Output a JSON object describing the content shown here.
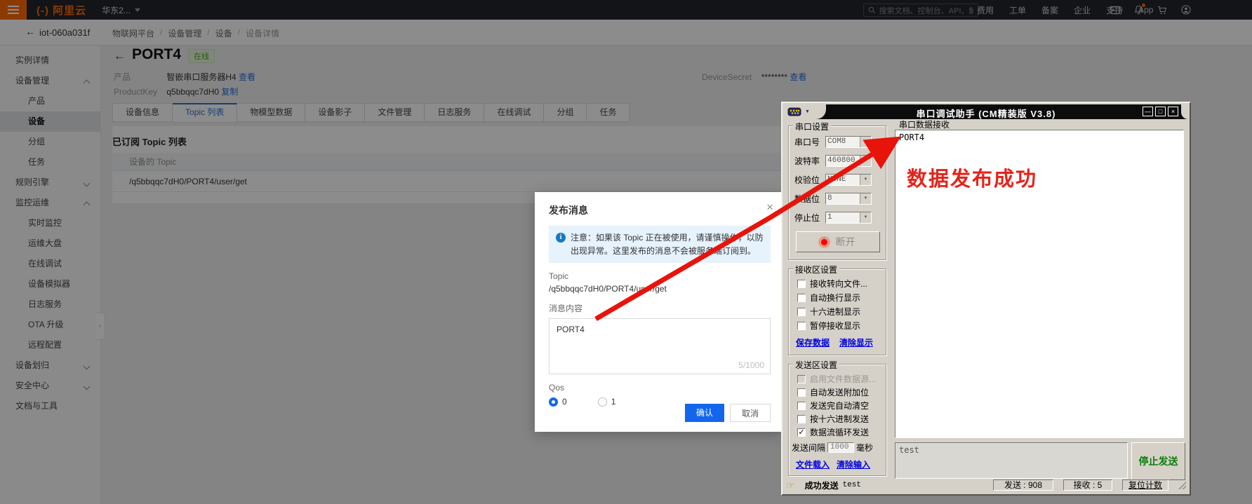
{
  "topbar": {
    "brand": "阿里云",
    "brand_mark": "(-)",
    "region": "华东2...",
    "search_placeholder": "搜索文档、控制台、API、解",
    "menu": [
      "费用",
      "工单",
      "备案",
      "企业",
      "支持",
      "App"
    ]
  },
  "subheader": {
    "back": "←",
    "instance": "iot-060a031f",
    "breadcrumb": [
      "物联网平台",
      "设备管理",
      "设备",
      "设备详情"
    ]
  },
  "sidebar": {
    "items": [
      {
        "label": "实例详情"
      },
      {
        "label": "设备管理"
      },
      {
        "label": "产品"
      },
      {
        "label": "设备"
      },
      {
        "label": "分组"
      },
      {
        "label": "任务"
      },
      {
        "label": "规则引擎"
      },
      {
        "label": "监控运维"
      },
      {
        "label": "实时监控"
      },
      {
        "label": "运维大盘"
      },
      {
        "label": "在线调试"
      },
      {
        "label": "设备模拟器"
      },
      {
        "label": "日志服务"
      },
      {
        "label": "OTA 升级"
      },
      {
        "label": "远程配置"
      },
      {
        "label": "设备划归"
      },
      {
        "label": "安全中心"
      },
      {
        "label": "文档与工具"
      }
    ],
    "collapse_glyph": "‹"
  },
  "device": {
    "back": "←",
    "title": "PORT4",
    "status": "在线",
    "product_label": "产品",
    "product_value": "智嵌串口服务器H4",
    "product_action": "查看",
    "pk_label": "ProductKey",
    "pk_value": "q5bbqqc7dH0",
    "pk_action": "复制",
    "secret_label": "DeviceSecret",
    "secret_value": "********",
    "secret_action": "查看"
  },
  "tabs": [
    "设备信息",
    "Topic 列表",
    "物模型数据",
    "设备影子",
    "文件管理",
    "日志服务",
    "在线调试",
    "分组",
    "任务"
  ],
  "topic_table": {
    "section_title": "已订阅 Topic 列表",
    "column": "设备的 Topic",
    "rows": [
      "/q5bbqqc7dH0/PORT4/user/get"
    ]
  },
  "modal": {
    "title": "发布消息",
    "close": "×",
    "notice": "注意：如果该 Topic 正在被使用，请谨慎操作，以防出现异常。这里发布的消息不会被服务端订阅到。",
    "topic_label": "Topic",
    "topic_value": "/q5bbqqc7dH0/PORT4/user/get",
    "content_label": "消息内容",
    "content_value": "PORT4",
    "counter": "5/1000",
    "qos_label": "Qos",
    "qos_options": [
      "0",
      "1"
    ],
    "confirm": "确认",
    "cancel": "取消"
  },
  "serial": {
    "title": "串口调试助手 (CM精装版 V3.8)",
    "win_buttons": {
      "min": "—",
      "max": "□",
      "close": "×"
    },
    "group_port": "串口设置",
    "port_rows": [
      {
        "label": "串口号",
        "value": "COM8"
      },
      {
        "label": "波特率",
        "value": "460800"
      },
      {
        "label": "校验位",
        "value": "NONE"
      },
      {
        "label": "数据位",
        "value": "8"
      },
      {
        "label": "停止位",
        "value": "1"
      }
    ],
    "disconnect": "断开",
    "group_recv": "接收区设置",
    "recv_checks": [
      "接收转向文件...",
      "自动换行显示",
      "十六进制显示",
      "暂停接收显示"
    ],
    "recv_links": [
      "保存数据",
      "清除显示"
    ],
    "group_send": "发送区设置",
    "send_checks": [
      "启用文件数据源...",
      "自动发送附加位",
      "发送完自动清空",
      "按十六进制发送",
      "数据流循环发送"
    ],
    "interval_label": "发送间隔",
    "interval_value": "1000",
    "interval_unit": "毫秒",
    "send_links": [
      "文件载入",
      "清除输入"
    ],
    "receive_label": "串口数据接收",
    "receive_text": "PORT4",
    "send_text": "test",
    "stop_button": "停止发送",
    "status": {
      "hand": "☞",
      "message": "成功发送",
      "payload": "test",
      "sent": "发送 : 908",
      "received": "接收 : 5",
      "reset": "复位计数"
    }
  },
  "annotation": {
    "text": "数据发布成功",
    "color": "#e4241b"
  }
}
